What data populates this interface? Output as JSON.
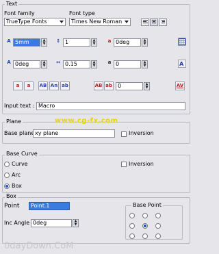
{
  "text_section": {
    "title": "Text",
    "font_family_label": "Font family",
    "font_family_value": "TrueType Fonts",
    "font_type_label": "Font type",
    "font_type_value": "Times New Roman",
    "size_value": "5mm",
    "ratio_value": "1",
    "slant_value": "0deg",
    "rotation_value": "0deg",
    "spacing_value": "0.15",
    "spacing2_value": "0",
    "style_buttons": [
      "a",
      "a",
      "AB",
      "An",
      "ab"
    ],
    "case_buttons": [
      "AB",
      "ab"
    ],
    "case_value": "0",
    "input_text_label": "Input text :",
    "input_text_value": "Macro"
  },
  "plane_section": {
    "title": "Plane",
    "base_plane_label": "Base plane",
    "base_plane_value": "xy plane",
    "inversion_label": "Inversion"
  },
  "base_curve_section": {
    "title": "Base Curve",
    "options": [
      "Curve",
      "Arc",
      "Box"
    ],
    "selected": "Box",
    "inversion_label": "Inversion"
  },
  "box_section": {
    "title": "Box",
    "point_label": "Point",
    "point_value": "Point.1",
    "inc_angle_label": "Inc Angle",
    "inc_angle_value": "0deg",
    "base_point_label": "Base Point"
  },
  "watermarks": {
    "center": "www.cg-fx.com",
    "bottom": "0dayDown.CoM"
  },
  "colors": {
    "background": "#e6e6ea",
    "selected": "#3a7be0",
    "watermark_center": "#e8d400"
  }
}
